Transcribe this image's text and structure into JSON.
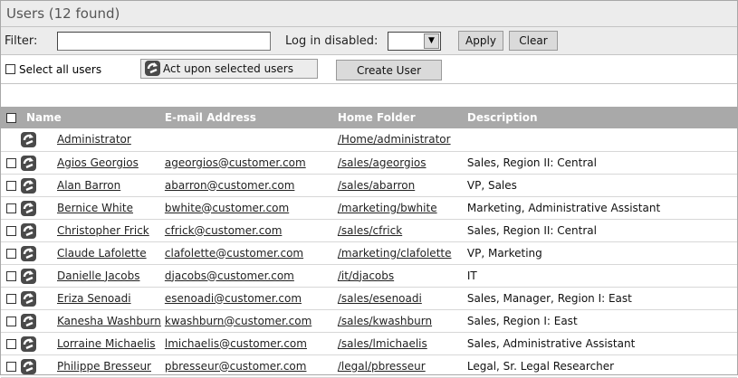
{
  "header": {
    "title": "Users (12 found)"
  },
  "filter": {
    "label": "Filter:",
    "value": "",
    "login_disabled_label": "Log in disabled:",
    "login_disabled_value": "",
    "apply_label": "Apply",
    "clear_label": "Clear"
  },
  "actions": {
    "select_all_label": "Select all users",
    "act_upon_label": "Act upon selected users",
    "create_user_label": "Create User"
  },
  "table": {
    "columns": [
      "Name",
      "E-mail Address",
      "Home Folder",
      "Description"
    ],
    "rows": [
      {
        "name": "Administrator",
        "email": "",
        "folder": "/Home/administrator",
        "description": "",
        "checkbox": false
      },
      {
        "name": "Agios Georgios",
        "email": "ageorgios@customer.com",
        "folder": "/sales/ageorgios",
        "description": "Sales, Region II: Central",
        "checkbox": true
      },
      {
        "name": "Alan Barron",
        "email": "abarron@customer.com",
        "folder": "/sales/abarron",
        "description": "VP, Sales",
        "checkbox": true
      },
      {
        "name": "Bernice White",
        "email": "bwhite@customer.com",
        "folder": "/marketing/bwhite",
        "description": "Marketing, Administrative Assistant",
        "checkbox": true
      },
      {
        "name": "Christopher Frick",
        "email": "cfrick@customer.com",
        "folder": "/sales/cfrick",
        "description": "Sales, Region II: Central",
        "checkbox": true
      },
      {
        "name": "Claude Lafolette",
        "email": "clafolette@customer.com",
        "folder": "/marketing/clafolette",
        "description": "VP, Marketing",
        "checkbox": true
      },
      {
        "name": "Danielle Jacobs",
        "email": "djacobs@customer.com",
        "folder": "/it/djacobs",
        "description": "IT",
        "checkbox": true
      },
      {
        "name": "Eriza Senoadi",
        "email": "esenoadi@customer.com",
        "folder": "/sales/esenoadi",
        "description": "Sales, Manager, Region I: East",
        "checkbox": true
      },
      {
        "name": "Kanesha Washburn",
        "email": "kwashburn@customer.com",
        "folder": "/sales/kwashburn",
        "description": "Sales, Region I: East",
        "checkbox": true
      },
      {
        "name": "Lorraine Michaelis",
        "email": "lmichaelis@customer.com",
        "folder": "/sales/lmichaelis",
        "description": "Sales, Administrative Assistant",
        "checkbox": true
      },
      {
        "name": "Philippe Bresseur",
        "email": "pbresseur@customer.com",
        "folder": "/legal/pbresseur",
        "description": "Legal, Sr. Legal Researcher",
        "checkbox": true
      }
    ]
  }
}
